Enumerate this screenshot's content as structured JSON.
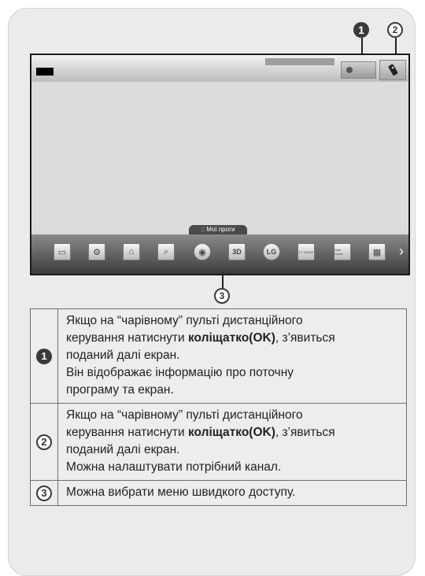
{
  "callouts": {
    "c1": "1",
    "c2": "2",
    "c3": "3"
  },
  "screen": {
    "dock_tab_label": "Мої проги",
    "dock_icons": [
      "settings-gear",
      "home",
      "search",
      "internet",
      "3d-world",
      "lg-logo",
      "tv-guide",
      "user-guide",
      "gallery"
    ],
    "tv_guide_label": "TV GUIDE",
    "user_guide_label": "User Guide",
    "lg_label": "LG",
    "threed_label": "3D"
  },
  "legend": {
    "rows": [
      {
        "number": "1",
        "lines_before": [
          "Якщо на “чарівному” пульті дистанційного"
        ],
        "line_bold_prefix": "керування натиснути ",
        "line_bold": "коліщатко(OK)",
        "line_bold_suffix": ", з’явиться",
        "lines_after": [
          "поданий далі екран.",
          "Він відображає інформацію про поточну",
          "програму та екран."
        ]
      },
      {
        "number": "2",
        "lines_before": [
          "Якщо на “чарівному” пульті дистанційного"
        ],
        "line_bold_prefix": "керування натиснути ",
        "line_bold": "коліщатко(OK)",
        "line_bold_suffix": ", з’явиться",
        "lines_after": [
          "поданий далі екран.",
          "Можна налаштувати потрібний канал."
        ]
      },
      {
        "number": "3",
        "text": "Можна вибрати меню швидкого доступу."
      }
    ]
  }
}
